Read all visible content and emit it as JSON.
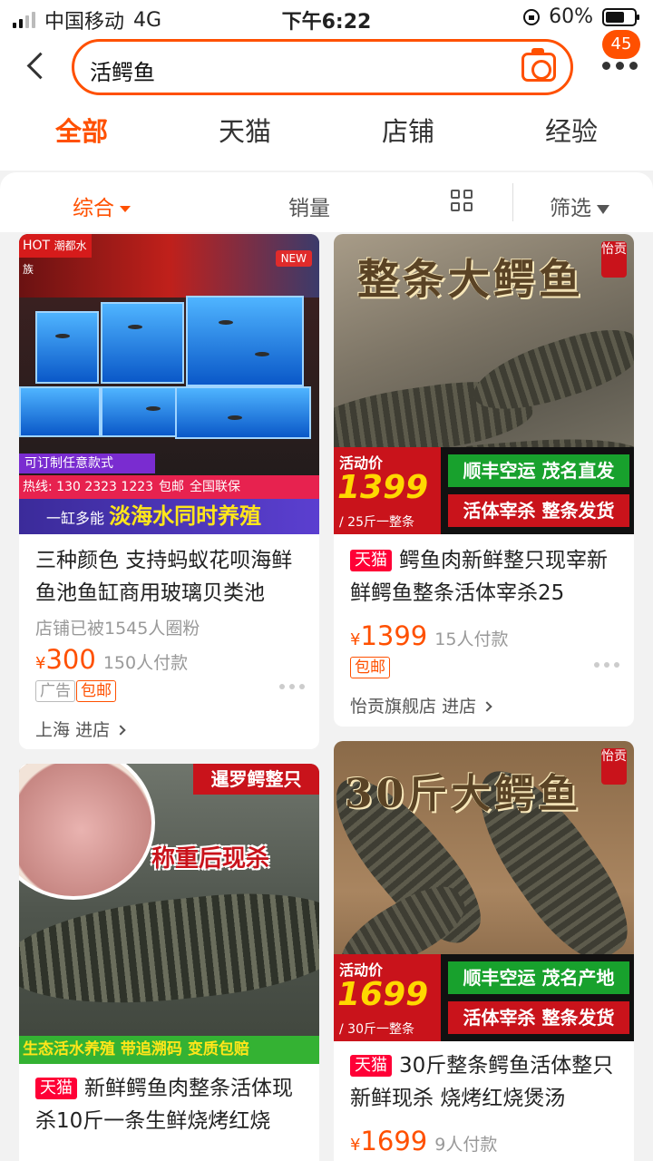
{
  "status_bar": {
    "carrier": "中国移动",
    "network": "4G",
    "time": "下午6:22",
    "battery": "60%"
  },
  "search": {
    "query": "活鳄鱼",
    "notification_count": "45"
  },
  "tabs": [
    {
      "label": "全部",
      "active": true
    },
    {
      "label": "天猫",
      "active": false
    },
    {
      "label": "店铺",
      "active": false
    },
    {
      "label": "经验",
      "active": false
    }
  ],
  "sort_bar": {
    "comprehensive": "综合",
    "sales": "销量",
    "filter": "筛选"
  },
  "products": [
    {
      "image": {
        "hot": "HOT",
        "brand": "潮都水族",
        "new": "NEW",
        "custom": "可订制任意款式",
        "hotline": "热线: 130 2323 1223",
        "free_shipping": "包邮",
        "warranty": "全国联保",
        "slogan_prefix": "一缸多能",
        "slogan": "淡海水同时养殖"
      },
      "title": "三种颜色 支持蚂蚁花呗海鲜鱼池鱼缸商用玻璃贝类池",
      "fans": "店铺已被1545人圈粉",
      "currency": "¥",
      "price": "300",
      "paid": "150人付款",
      "tags": [
        "广告",
        "包邮"
      ],
      "shop": "上海",
      "enter": "进店"
    },
    {
      "image": {
        "headline": "整条大鳄鱼",
        "seal": "怡贡",
        "promo_label": "活动价",
        "promo_price": "1399",
        "promo_unit": "/ 25斤一整条",
        "line1": "顺丰空运  茂名直发",
        "line2": "活体宰杀  整条发货"
      },
      "tmall": "天猫",
      "title": "鳄鱼肉新鲜整只现宰新鲜鳄鱼整条活体宰杀25",
      "currency": "¥",
      "price": "1399",
      "paid": "15人付款",
      "tags": [
        "包邮"
      ],
      "shop": "怡贡旗舰店",
      "enter": "进店"
    },
    {
      "image": {
        "banner": "暹罗鳄整只",
        "weigh": "称重后现杀",
        "bottom": "生态活水养殖  带追溯码  变质包赔"
      },
      "tmall": "天猫",
      "title": "新鲜鳄鱼肉整条活体现杀10斤一条生鲜烧烤红烧"
    },
    {
      "image": {
        "headline": "30斤大鳄鱼",
        "seal": "怡贡",
        "promo_label": "活动价",
        "promo_price": "1699",
        "promo_unit": "/ 30斤一整条",
        "line1": "顺丰空运  茂名产地",
        "line2": "活体宰杀  整条发货"
      },
      "tmall": "天猫",
      "title": "30斤整条鳄鱼活体整只新鲜现杀 烧烤红烧煲汤",
      "currency": "¥",
      "price": "1699",
      "paid": "9人付款"
    }
  ],
  "colors": {
    "accent": "#ff5000",
    "tmall_red": "#ff0036"
  }
}
